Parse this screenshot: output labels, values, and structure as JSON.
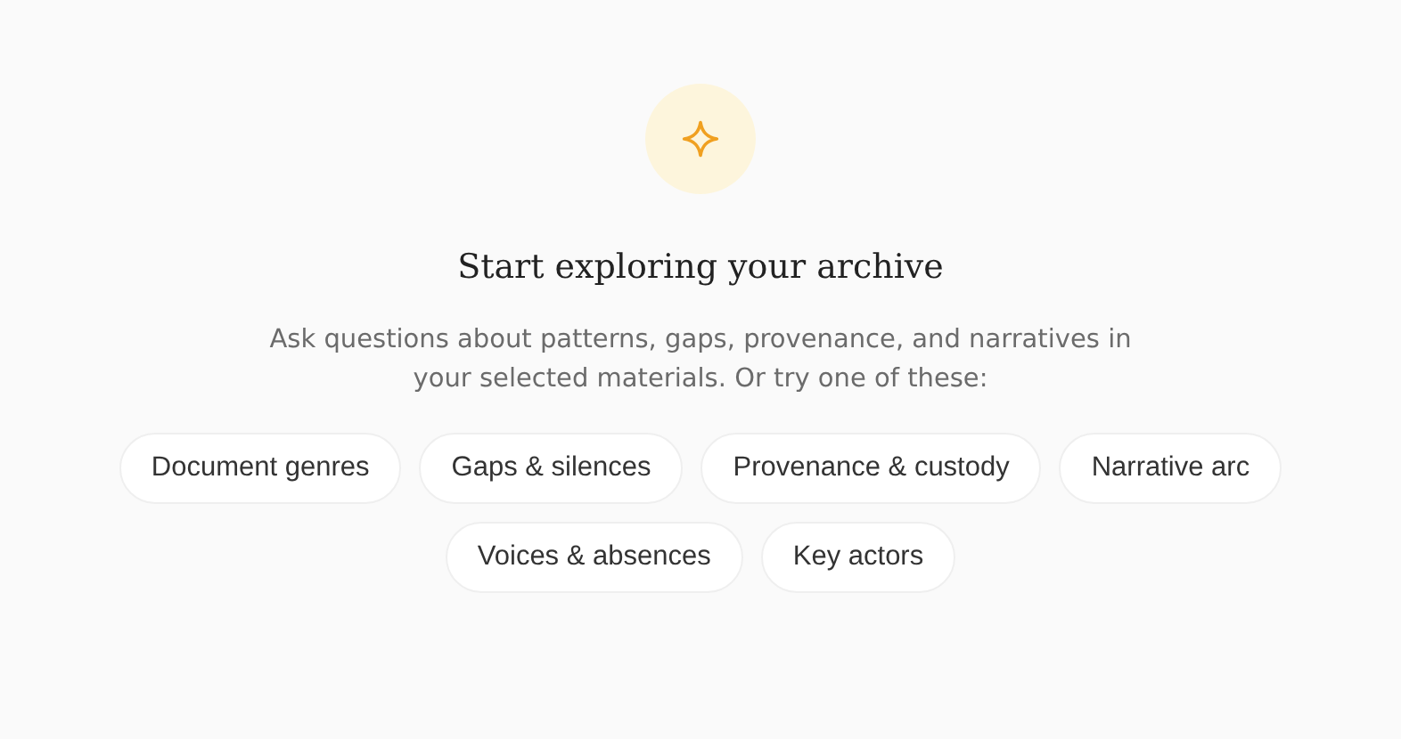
{
  "empty_state": {
    "title": "Start exploring your archive",
    "description": "Ask questions about patterns, gaps, provenance, and narratives in your selected materials. Or try one of these:"
  },
  "suggestions": [
    {
      "label": "Document genres"
    },
    {
      "label": "Gaps & silences"
    },
    {
      "label": "Provenance & custody"
    },
    {
      "label": "Narrative arc"
    },
    {
      "label": "Voices & absences"
    },
    {
      "label": "Key actors"
    }
  ]
}
